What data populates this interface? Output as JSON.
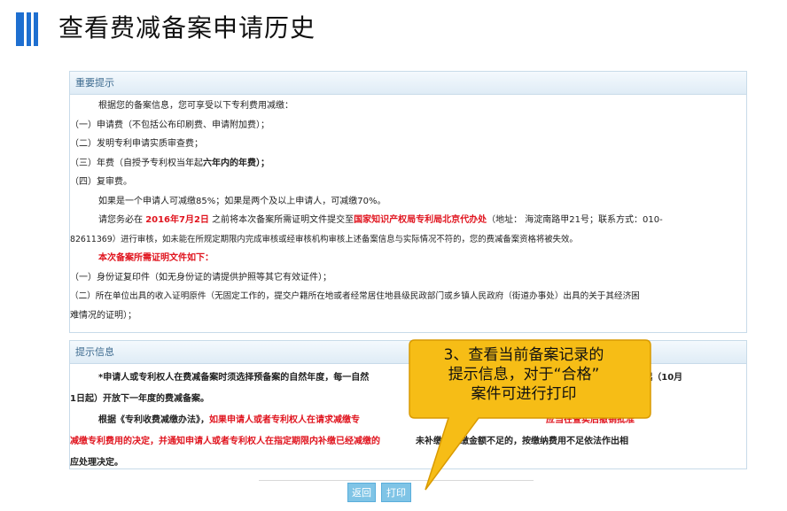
{
  "header": {
    "title": "查看费减备案申请历史"
  },
  "notice": {
    "heading": "重要提示",
    "intro": "根据您的备案信息，您可享受以下专利费用减缴：",
    "items": [
      "（一）申请费（不包括公布印刷费、申请附加费）；",
      "（二）发明专利申请实质审查费；",
      "（三）年费（自授予专利权当年起",
      "（四）复审费。"
    ],
    "item3_bold": "六年内的年费）；",
    "rate": "如果是一个申请人可减缴85%；如果是两个及以上申请人，可减缴70%。",
    "deadline_a": "请您务必在",
    "deadline_date": "2016年7月2日",
    "deadline_b": "之前将本次备案所需证明文件提交至",
    "deadline_office": "国家知识产权局专利局北京代办处",
    "deadline_c": "（地址： 海淀南路甲21号；联系方式：010-",
    "deadline_d": "82611369）进行审核，如未能在所规定期限内完成审核或经审核机构审核上述备案信息与实际情况不符的，您的费减备案资格将被失效。",
    "docs_title": "本次备案所需证明文件如下：",
    "docs": [
      "（一）身份证复印件（如无身份证的请提供护照等其它有效证件）；",
      "（二）所在单位出具的收入证明原件（无固定工作的，提交户籍所在地或者经常居住地县级民政部门或乡镇人民政府（街道办事处）出具的关于其经济困",
      "难情况的证明）；"
    ]
  },
  "tips": {
    "heading": "提示信息",
    "line1_a": "*申请人或专利权人在费减备案时须选择预备案的自然年度，每一自然",
    "line1_b": "的第四个季度起（10月",
    "line2": "1日起）开放下一年度的费减备案。",
    "line3_a": "根据《专利收费减缴办法》，",
    "line3_red": "如果申请人或者专利权人在请求减缴专",
    "line3_red2": "应当在查实后撤销批准",
    "line4_red": "减缴专利费用的决定，并通知申请人或者专利权人在指定期限内补缴已经减缴的",
    "line4_b": "未补缴或补缴金额不足的，按缴纳费用不足依法作出相",
    "line5": "应处理决定。"
  },
  "buttons": {
    "back": "返回",
    "print": "打印"
  },
  "callout": {
    "lines": [
      "3、查看当前备案记录的",
      "提示信息，对于“合格”",
      "案件可进行打印"
    ],
    "fill": "#f6bd16",
    "stroke": "#d99a00"
  }
}
